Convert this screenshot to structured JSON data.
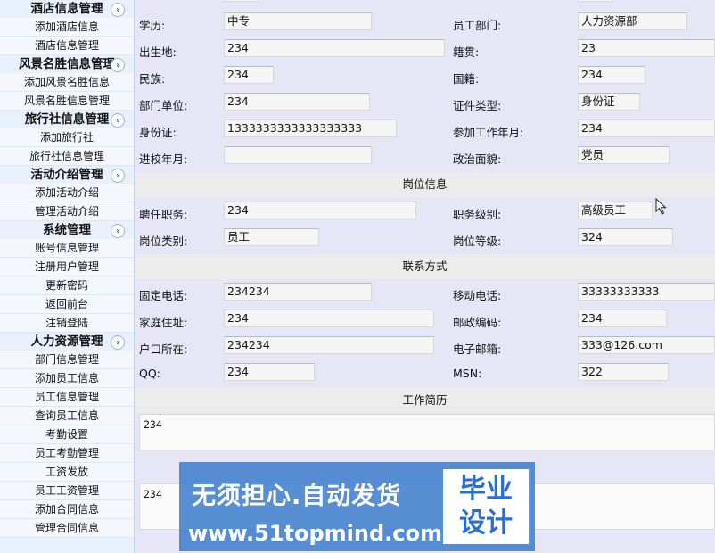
{
  "sidebar": {
    "groups": [
      {
        "title": "酒店信息管理",
        "items": [
          "添加酒店信息",
          "酒店信息管理"
        ]
      },
      {
        "title": "风景名胜信息管理",
        "items": [
          "添加风景名胜信息",
          "风景名胜信息管理"
        ]
      },
      {
        "title": "旅行社信息管理",
        "items": [
          "添加旅行社",
          "旅行社信息管理"
        ]
      },
      {
        "title": "活动介绍管理",
        "items": [
          "添加活动介绍",
          "管理活动介绍"
        ]
      },
      {
        "title": "系统管理",
        "items": [
          "账号信息管理",
          "注册用户管理",
          "更新密码",
          "返回前台",
          "注销登陆"
        ]
      },
      {
        "title": "人力资源管理",
        "items": [
          "部门信息管理",
          "添加员工信息",
          "员工信息管理",
          "查询员工信息",
          "考勤设置",
          "员工考勤管理",
          "工资发放",
          "员工工资管理",
          "添加合同信息",
          "管理合同信息"
        ]
      }
    ],
    "chevron": "chevron-double-down-icon"
  },
  "form": {
    "education_label": "学历:",
    "education_value": "中专",
    "department_label": "员工部门:",
    "department_value": "人力资源部",
    "birthplace_label": "出生地:",
    "birthplace_value": "234",
    "native_label": "籍贯:",
    "native_value": "23",
    "ethnic_label": "民族:",
    "ethnic_value": "234",
    "nationality_label": "国籍:",
    "nationality_value": "234",
    "unit_label": "部门单位:",
    "unit_value": "234",
    "idtype_label": "证件类型:",
    "idtype_value": "身份证",
    "idcard_label": "身份证:",
    "idcard_value": "1333333333333333333",
    "workstart_label": "参加工作年月:",
    "workstart_value": "234",
    "schoolin_label": "进校年月:",
    "schoolin_value": "",
    "political_label": "政治面貌:",
    "political_value": "党员",
    "section_post": "岗位信息",
    "hire_label": "聘任职务:",
    "hire_value": "234",
    "rank_label": "职务级别:",
    "rank_value": "高级员工",
    "posttype_label": "岗位类别:",
    "posttype_value": "员工",
    "postlevel_label": "岗位等级:",
    "postlevel_value": "324",
    "section_contact": "联系方式",
    "phone_label": "固定电话:",
    "phone_value": "234234",
    "mobile_label": "移动电话:",
    "mobile_value": "33333333333",
    "address_label": "家庭住址:",
    "address_value": "234",
    "zip_label": "邮政编码:",
    "zip_value": "234",
    "hukou_label": "户口所在:",
    "hukou_value": "234234",
    "email_label": "电子邮箱:",
    "email_value": "333@126.com",
    "qq_label": "QQ:",
    "qq_value": "234",
    "msn_label": "MSN:",
    "msn_value": "322",
    "section_resume": "工作简历",
    "resume_value": "234",
    "textarea2_value": "234"
  },
  "watermark": {
    "line1": "无须担心.自动发货",
    "line2": "www.51topmind.com",
    "badge1": "毕业",
    "badge2": "设计"
  }
}
